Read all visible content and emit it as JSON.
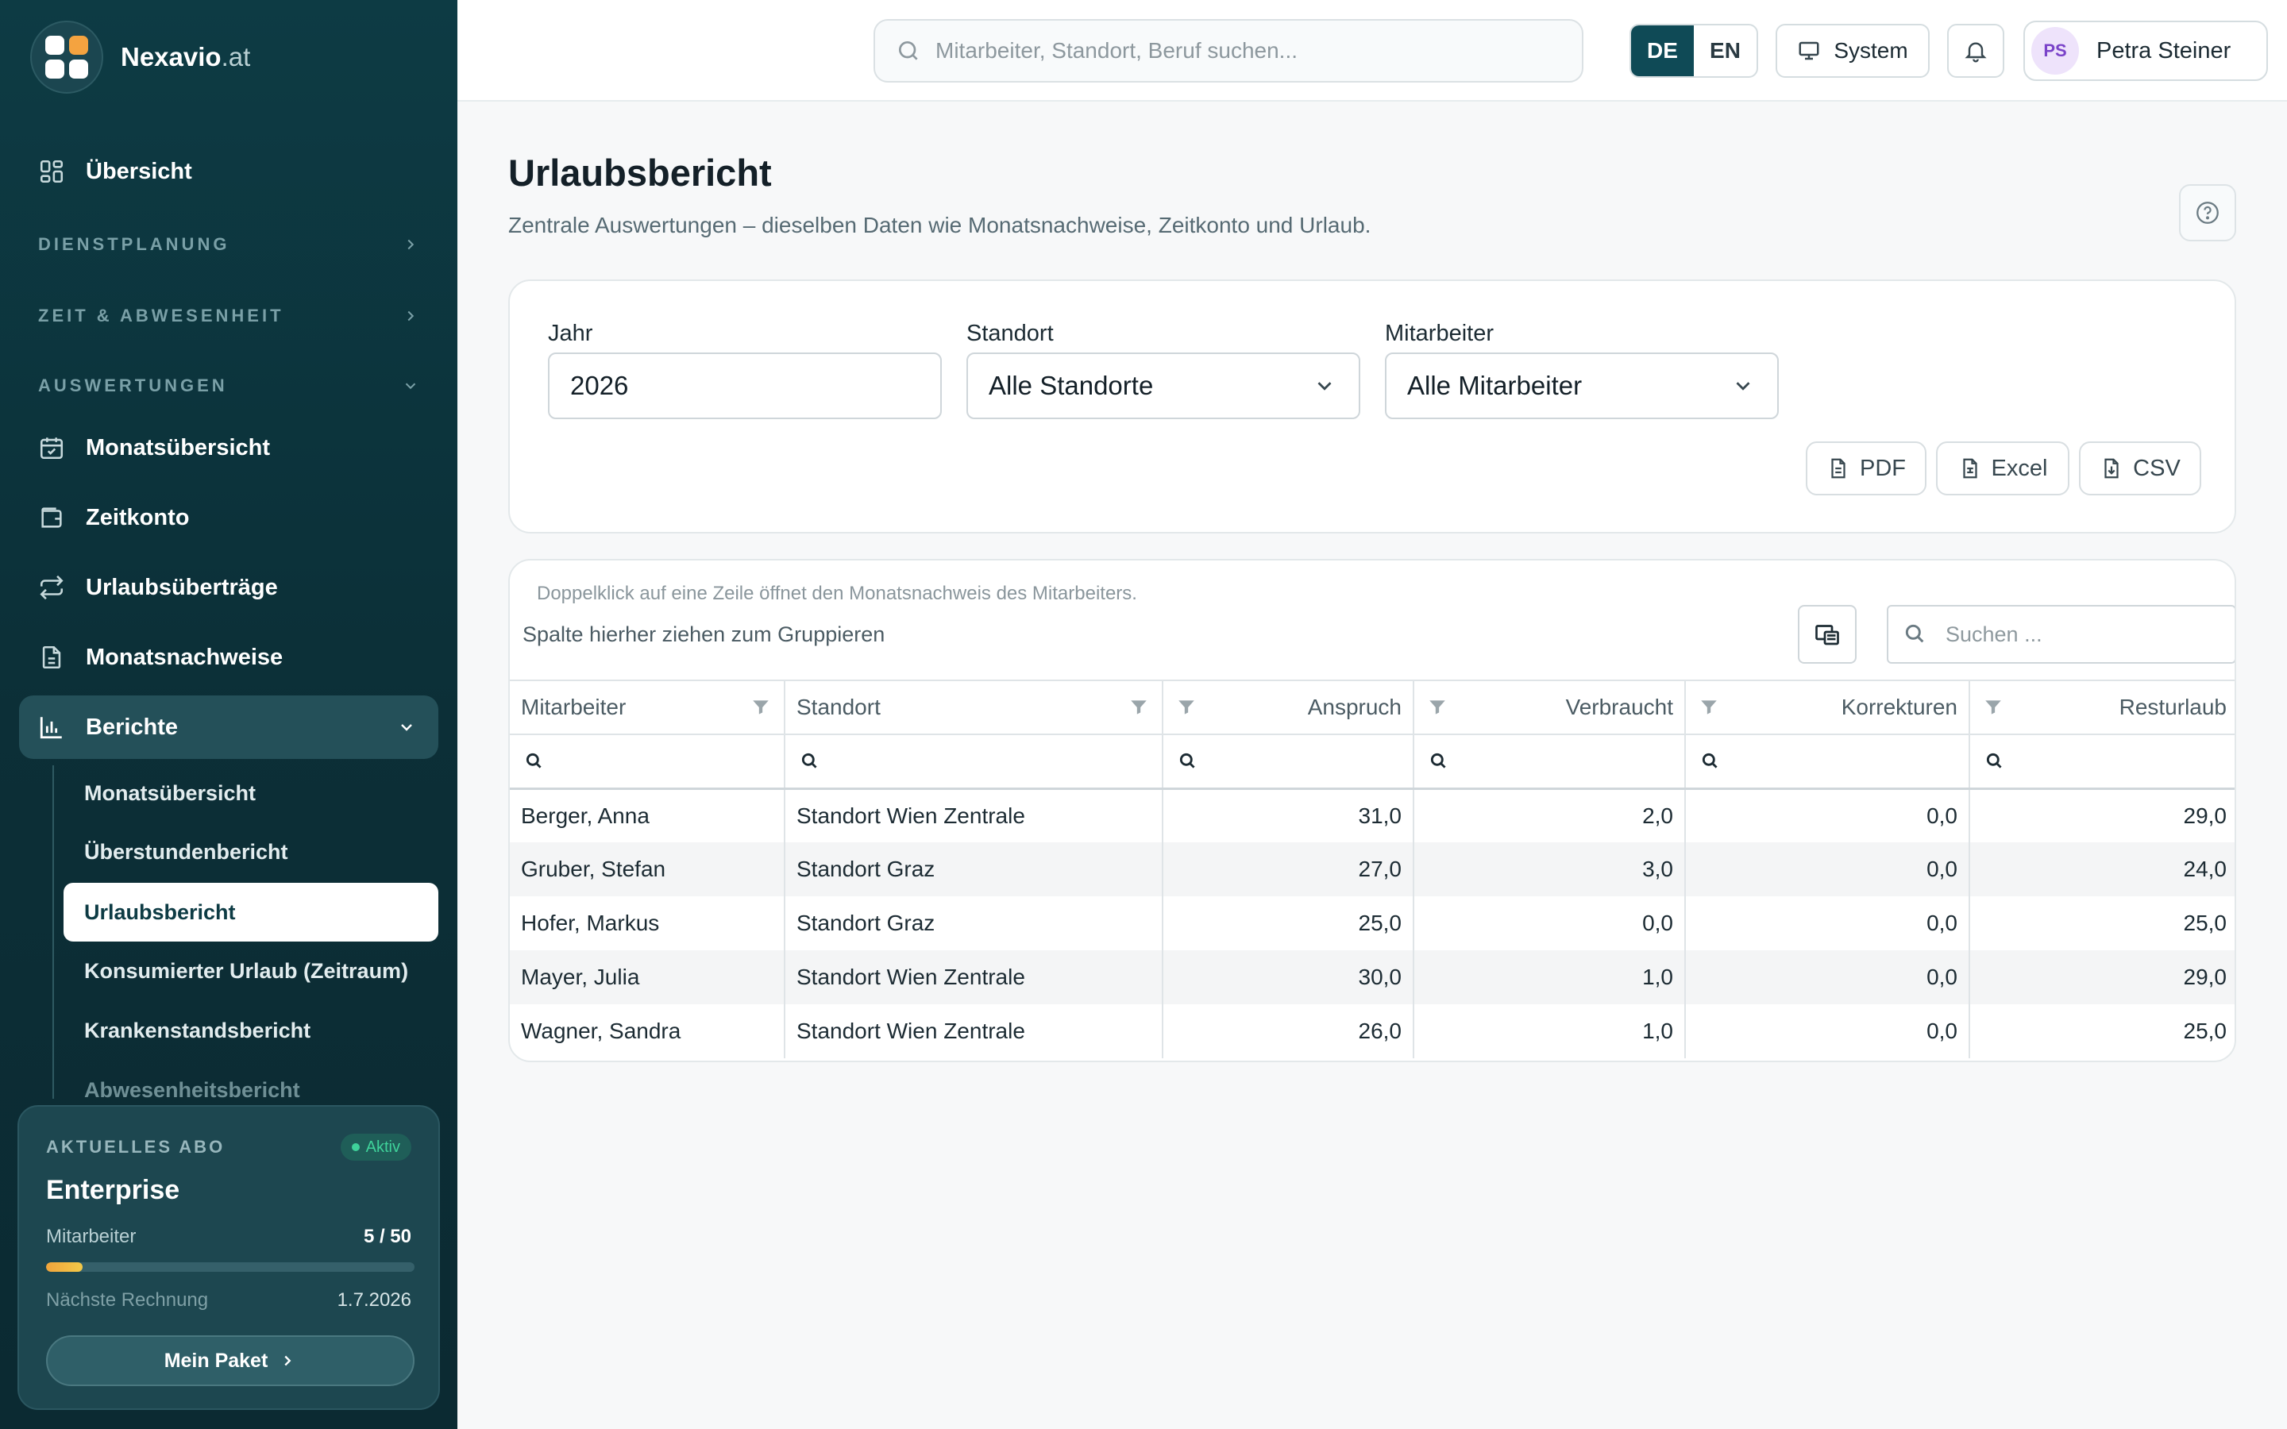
{
  "brand": {
    "name": "Nexavio",
    "tld": ".at"
  },
  "nav": {
    "overview": "Übersicht",
    "sections": {
      "planning": "DIENSTPLANUNG",
      "time": "ZEIT & ABWESENHEIT",
      "reports": "AUSWERTUNGEN"
    },
    "items": [
      "Monatsübersicht",
      "Zeitkonto",
      "Urlaubsüberträge",
      "Monatsnachweise"
    ],
    "reports_group": "Berichte",
    "sub_items": [
      "Monatsübersicht",
      "Überstundenbericht",
      "Urlaubsbericht",
      "Konsumierter Urlaub (Zeitraum)",
      "Krankenstandsbericht",
      "Abwesenheitsbericht"
    ]
  },
  "plan": {
    "label": "AKTUELLES ABO",
    "badge": "Aktiv",
    "name": "Enterprise",
    "employees_label": "Mitarbeiter",
    "employees_value": "5 / 50",
    "employees_fraction": 0.1,
    "next_invoice_label": "Nächste Rechnung",
    "next_invoice_value": "1.7.2026",
    "button": "Mein Paket"
  },
  "header": {
    "search_placeholder": "Mitarbeiter, Standort, Beruf suchen...",
    "lang": [
      "DE",
      "EN"
    ],
    "lang_active": "DE",
    "theme": "System",
    "user": {
      "initials": "PS",
      "name": "Petra Steiner"
    }
  },
  "page": {
    "title": "Urlaubsbericht",
    "subtitle": "Zentrale Auswertungen – dieselben Daten wie Monatsnachweise, Zeitkonto und Urlaub."
  },
  "filters": {
    "year": {
      "label": "Jahr",
      "value": "2026"
    },
    "location": {
      "label": "Standort",
      "value": "Alle Standorte"
    },
    "employee": {
      "label": "Mitarbeiter",
      "value": "Alle Mitarbeiter"
    },
    "exports": [
      "PDF",
      "Excel",
      "CSV"
    ]
  },
  "grid": {
    "hint": "Doppelklick auf eine Zeile öffnet den Monatsnachweis des Mitarbeiters.",
    "group_panel": "Spalte hierher ziehen zum Gruppieren",
    "search_placeholder": "Suchen ...",
    "columns": [
      "Mitarbeiter",
      "Standort",
      "Anspruch",
      "Verbraucht",
      "Korrekturen",
      "Resturlaub"
    ],
    "rows": [
      [
        "Berger, Anna",
        "Standort Wien Zentrale",
        "31,0",
        "2,0",
        "0,0",
        "29,0"
      ],
      [
        "Gruber, Stefan",
        "Standort Graz",
        "27,0",
        "3,0",
        "0,0",
        "24,0"
      ],
      [
        "Hofer, Markus",
        "Standort Graz",
        "25,0",
        "0,0",
        "0,0",
        "25,0"
      ],
      [
        "Mayer, Julia",
        "Standort Wien Zentrale",
        "30,0",
        "1,0",
        "0,0",
        "29,0"
      ],
      [
        "Wagner, Sandra",
        "Standort Wien Zentrale",
        "26,0",
        "1,0",
        "0,0",
        "25,0"
      ]
    ]
  },
  "colors": {
    "primary": "#0f4a56",
    "sidebar": "#0d3b44",
    "accent": "#f4a340",
    "success": "#3fd29a"
  }
}
